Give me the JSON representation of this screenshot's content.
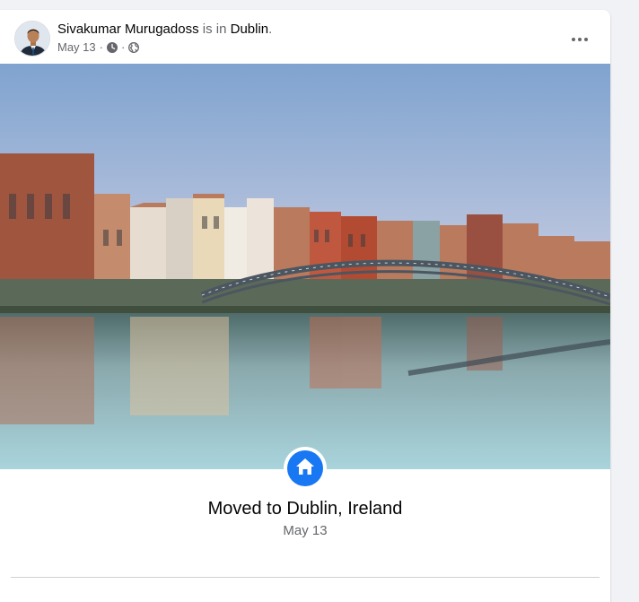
{
  "post": {
    "author": "Sivakumar Murugadoss",
    "connector": "is in",
    "location": "Dublin",
    "period": ".",
    "date": "May 13",
    "separator": "·"
  },
  "icons": {
    "more": "more-options-icon",
    "clock": "clock-icon",
    "privacy": "globe-icon",
    "event": "home-icon"
  },
  "life_event": {
    "title": "Moved to Dublin, Ireland",
    "date": "May 13"
  },
  "colors": {
    "accent": "#1877f2",
    "text_primary": "#050505",
    "text_secondary": "#65676b",
    "page_background": "#f0f2f5"
  }
}
